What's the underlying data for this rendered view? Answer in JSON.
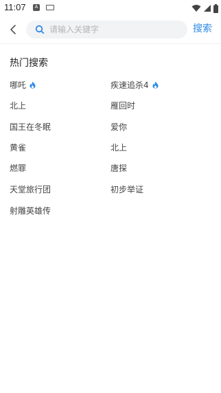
{
  "status_bar": {
    "time": "11:07",
    "icons": [
      "notification-a-icon",
      "keyboard-icon",
      "wifi-icon",
      "signal-icon",
      "battery-icon"
    ]
  },
  "header": {
    "back_icon": "chevron-left-icon",
    "search_placeholder": "请输入关键字",
    "search_value": "",
    "search_button": "搜索"
  },
  "hot_search": {
    "title": "热门搜索",
    "items": [
      {
        "label": "哪吒",
        "hot": true
      },
      {
        "label": "疾速追杀4",
        "hot": true
      },
      {
        "label": "北上",
        "hot": false
      },
      {
        "label": "雁回时",
        "hot": false
      },
      {
        "label": "国王在冬眠",
        "hot": false
      },
      {
        "label": "爱你",
        "hot": false
      },
      {
        "label": "黄雀",
        "hot": false
      },
      {
        "label": "北上",
        "hot": false
      },
      {
        "label": "燃罪",
        "hot": false
      },
      {
        "label": "唐探",
        "hot": false
      },
      {
        "label": "天堂旅行团",
        "hot": false
      },
      {
        "label": "初步举证",
        "hot": false
      },
      {
        "label": "射雕英雄传",
        "hot": false
      }
    ]
  },
  "colors": {
    "accent": "#2f8ae5",
    "fire": "#2f8ae5",
    "search_bg": "#f2f3f5"
  }
}
